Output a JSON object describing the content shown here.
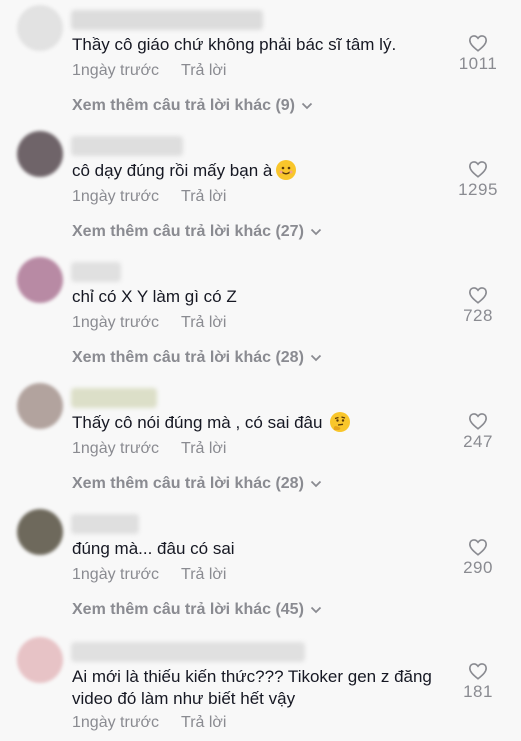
{
  "colors": {
    "background": "#f8f8f8",
    "text": "#161823",
    "muted": "#8a8b91"
  },
  "comments": [
    {
      "avatar_color": "#e2e2e2",
      "name_color": "#dcdcdc",
      "text": "Thầy cô giáo chứ không phải bác sĩ tâm lý.",
      "time": "1ngày trước",
      "reply": "Trả lời",
      "likes": "1011",
      "more": "Xem thêm câu trả lời khác (9)"
    },
    {
      "avatar_color": "#6f6469",
      "name_color": "#dedede",
      "text": "cô dạy đúng rồi mấy bạn à",
      "emoji": "smile-emoji",
      "time": "1ngày trước",
      "reply": "Trả lời",
      "likes": "1295",
      "more": "Xem thêm câu trả lời khác (27)"
    },
    {
      "avatar_color": "#b88aa4",
      "name_color": "#e0e0e0",
      "text": "chỉ có X Y làm gì có Z",
      "time": "1ngày trước",
      "reply": "Trả lời",
      "likes": "728",
      "more": "Xem thêm câu trả lời khác (28)"
    },
    {
      "avatar_color": "#b2a39e",
      "name_color": "#dcdfc8",
      "text": "Thấy cô nói đúng mà , có sai đâu",
      "emoji": "thinking-emoji",
      "time": "1ngày trước",
      "reply": "Trả lời",
      "likes": "247",
      "more": "Xem thêm câu trả lời khác (28)"
    },
    {
      "avatar_color": "#6e695c",
      "name_color": "#dfdfdf",
      "text": "đúng mà... đâu có sai",
      "time": "1ngày trước",
      "reply": "Trả lời",
      "likes": "290",
      "more": "Xem thêm câu trả lời khác (45)"
    },
    {
      "avatar_color": "#e7c3c6",
      "name_color": "#e0e0e0",
      "text": "Ai mới là thiếu kiến thức??? Tikoker gen z đăng video đó làm như biết hết vậy",
      "time": "1ngày trước",
      "reply": "Trả lời",
      "likes": "181"
    }
  ]
}
